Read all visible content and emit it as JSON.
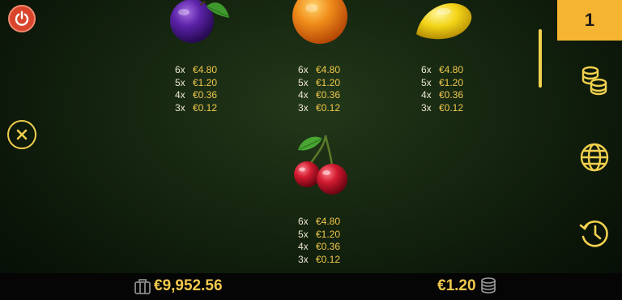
{
  "header": {
    "page_number": "1"
  },
  "paytable": [
    {
      "symbol": "plum-icon",
      "rows": [
        {
          "mult": "6x",
          "amount": "€4.80"
        },
        {
          "mult": "5x",
          "amount": "€1.20"
        },
        {
          "mult": "4x",
          "amount": "€0.36"
        },
        {
          "mult": "3x",
          "amount": "€0.12"
        }
      ]
    },
    {
      "symbol": "orange-icon",
      "rows": [
        {
          "mult": "6x",
          "amount": "€4.80"
        },
        {
          "mult": "5x",
          "amount": "€1.20"
        },
        {
          "mult": "4x",
          "amount": "€0.36"
        },
        {
          "mult": "3x",
          "amount": "€0.12"
        }
      ]
    },
    {
      "symbol": "lemon-icon",
      "rows": [
        {
          "mult": "6x",
          "amount": "€4.80"
        },
        {
          "mult": "5x",
          "amount": "€1.20"
        },
        {
          "mult": "4x",
          "amount": "€0.36"
        },
        {
          "mult": "3x",
          "amount": "€0.12"
        }
      ]
    },
    {
      "symbol": "cherries-icon",
      "rows": [
        {
          "mult": "6x",
          "amount": "€4.80"
        },
        {
          "mult": "5x",
          "amount": "€1.20"
        },
        {
          "mult": "4x",
          "amount": "€0.36"
        },
        {
          "mult": "3x",
          "amount": "€0.12"
        }
      ]
    }
  ],
  "sidebar": {
    "icons": [
      "coins-stack-icon",
      "globe-icon",
      "history-icon"
    ]
  },
  "footer": {
    "balance": "€9,952.56",
    "bet": "€1.20"
  },
  "colors": {
    "accent": "#f2c94c",
    "tab": "#f5b431",
    "power": "#d8452c"
  }
}
